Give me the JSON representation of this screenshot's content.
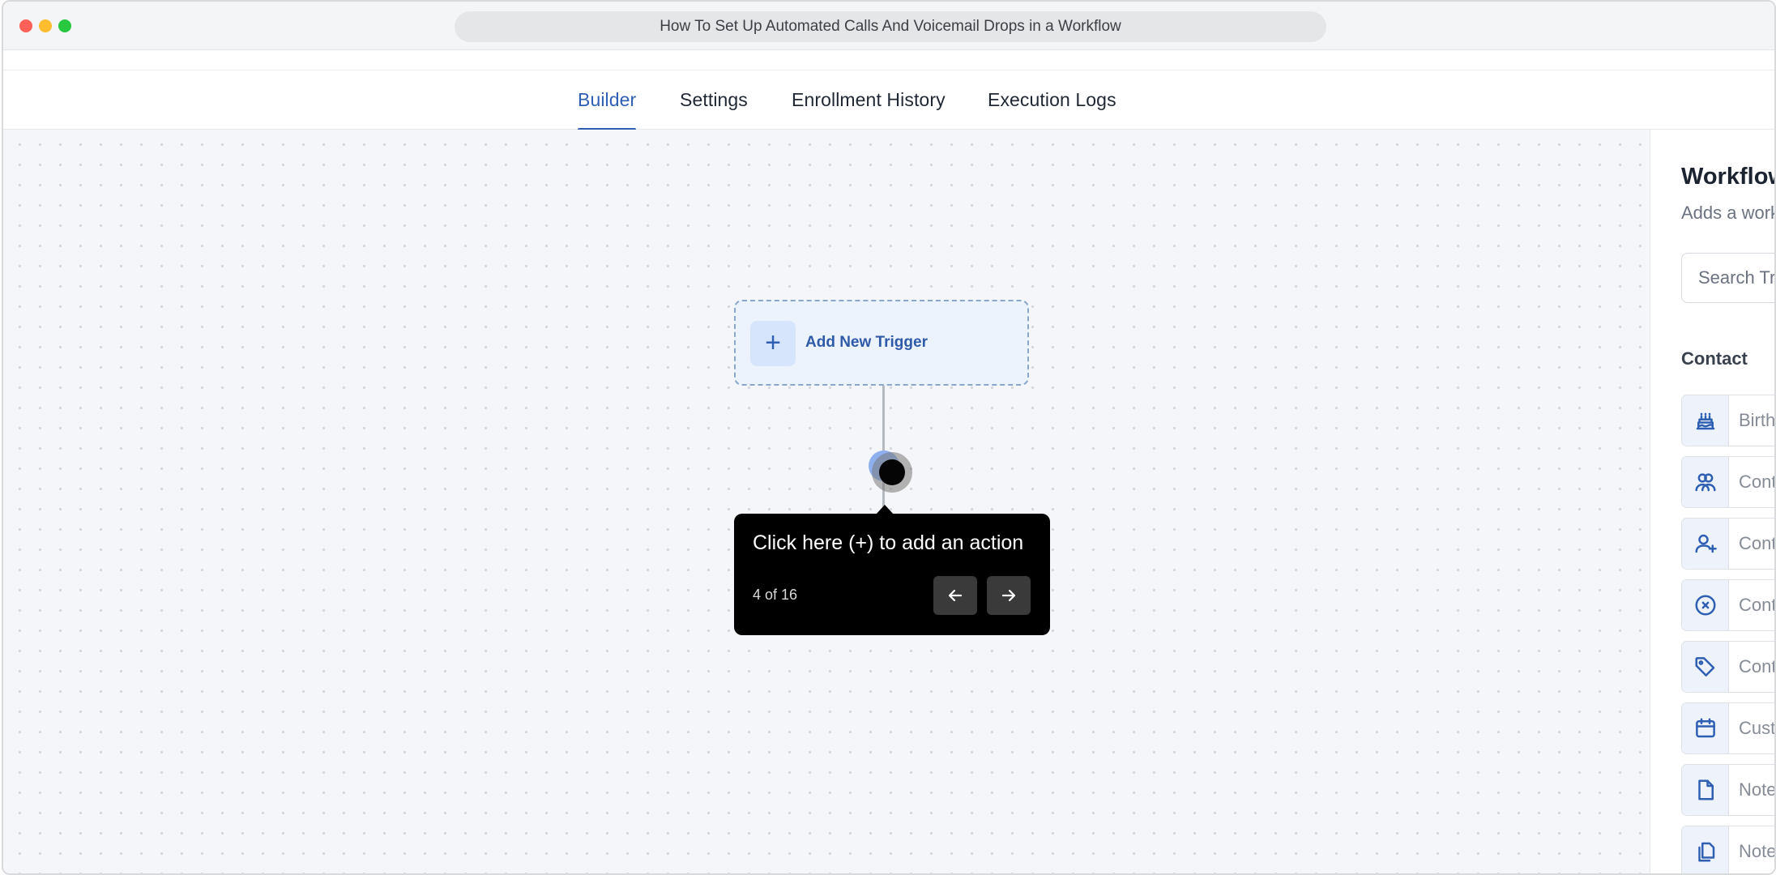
{
  "window": {
    "title": "How To Set Up Automated Calls And Voicemail Drops in a Workflow"
  },
  "tabs": [
    {
      "label": "Builder",
      "active": true
    },
    {
      "label": "Settings",
      "active": false
    },
    {
      "label": "Enrollment History",
      "active": false
    },
    {
      "label": "Execution Logs",
      "active": false
    }
  ],
  "canvas": {
    "trigger_label": "Add New Trigger",
    "trigger_icon": "plus-icon",
    "add_action_icon": "plus-icon"
  },
  "tooltip": {
    "text": "Click here (+) to add an action",
    "step": "4 of 16",
    "prev_icon": "arrow-left-icon",
    "next_icon": "arrow-right-icon"
  },
  "panel": {
    "title": "Workflow",
    "subtitle": "Adds a workf",
    "search_placeholder": "Search Tri",
    "section": "Contact",
    "items": [
      {
        "label": "Birthd",
        "icon": "cake-icon"
      },
      {
        "label": "Conta",
        "icon": "users-icon"
      },
      {
        "label": "Conta",
        "icon": "user-plus-icon"
      },
      {
        "label": "Conta",
        "icon": "x-circle-icon"
      },
      {
        "label": "Conta",
        "icon": "tag-icon"
      },
      {
        "label": "Custo",
        "icon": "calendar-icon"
      },
      {
        "label": "Note",
        "icon": "file-icon"
      },
      {
        "label": "Note",
        "icon": "copy-icon"
      }
    ]
  },
  "colors": {
    "accent": "#2f5fb3",
    "tooltip_bg": "#000000",
    "canvas_bg": "#f5f6f9"
  }
}
